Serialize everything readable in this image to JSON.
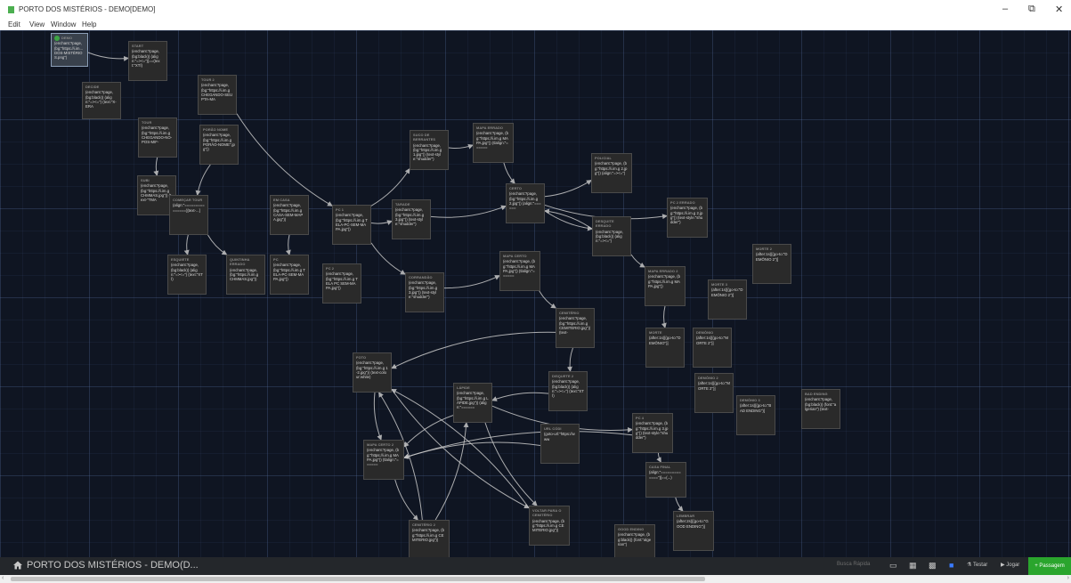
{
  "window": {
    "title": "PORTO DOS MISTÉRIOS - DEMO[DEMO]",
    "minimize": "–",
    "maximize": "⧉",
    "close": "✕"
  },
  "menu": [
    "Edit",
    "View",
    "Window",
    "Help"
  ],
  "colors": {
    "canvas_bg": "#0f1522",
    "passage_bg": "#2a2a2a",
    "link": "#c8c8c8",
    "accent_green": "#2aa52d",
    "selected_blue": "#3a7bff"
  },
  "passages": [
    {
      "id": "p0",
      "name": "DEMO",
      "excerpt": "(enchant:?page, (bg:\"https://i.im... DOS-MISTÉRIOS.png\")",
      "start": true
    },
    {
      "id": "p1",
      "name": "START",
      "excerpt": "(enchant:?page, (bg:black)) (align:\"=><=\")[==(text:\"XTÍ)"
    },
    {
      "id": "p2",
      "name": "DECIDE",
      "excerpt": "(enchant:?page, (bg:black)) (align:\"=><=\") (text:\"X-ERA"
    },
    {
      "id": "p3",
      "name": "TOUR 2",
      "excerpt": "(enchant:?page, (bg:\"https://i.im.g CHEGANDO-SEUPTA-MA"
    },
    {
      "id": "p4",
      "name": "TOUR",
      "excerpt": "(enchant:?page, (bg:\"https://i.im.g CHEGANDO-NO-POS-MIF-"
    },
    {
      "id": "p5",
      "name": "PORÃO NOME",
      "excerpt": "(enchant:?page, (bg:\"https://i.im.g PORÃO-NOME\".jpg\"))"
    },
    {
      "id": "p6",
      "name": "SUBI",
      "excerpt": "(enchant:?page, (bg:\"https://i.im.g CHMMAS.jpg\")) (text-\"TMA"
    },
    {
      "id": "p7",
      "name": "COMEÇAR TOUR",
      "excerpt": "(align:\"===============)[text-...]"
    },
    {
      "id": "p8",
      "name": "EM CASA",
      "excerpt": "(enchant:?page, (bg:\"https://i.im.g CASA-SEM-MAPA.jpg\"))"
    },
    {
      "id": "p9",
      "name": "PC 1",
      "excerpt": "(enchant:?page, (bg:\"https://i.im.g TELA-PC-SEM-MAPA.jpg\"))"
    },
    {
      "id": "p10",
      "name": "SUCO DE BERRANTES",
      "excerpt": "(enchant:?page, (bg:\"https://i.im.g 1.jpg\")) (text-style:\"shudder\")"
    },
    {
      "id": "p11",
      "name": "MAPA ERRADO",
      "excerpt": "(enchant:?page, (bg:\"https://i.im.g MAPA.jpg\")) (tlalign:\"======"
    },
    {
      "id": "p12",
      "name": "POLICIAL",
      "excerpt": "(enchant:?page, (bg:\"https://i.im.g 2.jpg\")) (align:\"=><=\")"
    },
    {
      "id": "p13",
      "name": "TARADE",
      "excerpt": "(enchant:?page, (bg:\"https://i.im.g 3.jpg\")) (text-style:\"shudder\")"
    },
    {
      "id": "p14",
      "name": "CERTO",
      "excerpt": "(enchant:?page, (bg:\"https://i.im.g 2.jpg\")) (align:\"======"
    },
    {
      "id": "p15",
      "name": "PC 2 ERRADO",
      "excerpt": "(enchant:?page, (bg:\"https://i.im.g 2.jpg\")) (text-style:\"shudder\")"
    },
    {
      "id": "p16",
      "name": "DESQUITE ERRADO",
      "excerpt": "(enchant:?page, (bg:black)) (align:\"=><=\")"
    },
    {
      "id": "p17",
      "name": "ESQUIETE",
      "excerpt": "(enchant:?page, (bg:black)) (align:\"=><=\") (text:\"XTÍ)"
    },
    {
      "id": "p18",
      "name": "QUINTINHA ERRADO",
      "excerpt": "(enchant:?page, (bg:\"https://i.im.g CHMMAS.jpg\"))"
    },
    {
      "id": "p19",
      "name": "PC",
      "excerpt": "(enchant:?page, (bg:\"https://i.im.g TELA-PC-SEM-MAPA.jpg\"))"
    },
    {
      "id": "p20",
      "name": "PC 2",
      "excerpt": "(enchant:?page, (bg:\"https://i.im.g TELA PC SEM-MAPA.jpg\"))"
    },
    {
      "id": "p21",
      "name": "CORRANDÃO",
      "excerpt": "(enchant:?page, (bg:\"https://i.im.g 3.jpg\")) (text-style:\"shudder\")"
    },
    {
      "id": "p22",
      "name": "MAPA CERTO",
      "excerpt": "(enchant:?page, (bg:\"https://i.im.g MAPA.jpg\")) (tlalign:\"======"
    },
    {
      "id": "p23",
      "name": "MAPA ERRADO 2",
      "excerpt": "(enchant:?page, (bg:\"https://i.im.g MAPA.jpg\"))"
    },
    {
      "id": "p24",
      "name": "MORTE 2",
      "excerpt": "(after:1s)[(go-to:\"DEMÔNIO 2\")]"
    },
    {
      "id": "p25",
      "name": "MORTE 3",
      "excerpt": "(after:1s)[(go-to:\"DEMÔNIO 2\")]"
    },
    {
      "id": "p26",
      "name": "CEMITÉRIO",
      "excerpt": "(enchant:?page, (bg:\"https://i.im.g CEMITERIO.jpg\")) (text-"
    },
    {
      "id": "p27",
      "name": "MORTE",
      "excerpt": "(after:1s)[(go-to:\"DEMÔNIO\")]"
    },
    {
      "id": "p28",
      "name": "DEMÔNIO",
      "excerpt": "(after:1s)[(go-to:\"MORTE 2\")]"
    },
    {
      "id": "p29",
      "name": "DEMÔNIO 2",
      "excerpt": "(after:1s)[(go-to:\"MORTE 2\")]"
    },
    {
      "id": "p30",
      "name": "FOTO",
      "excerpt": "(enchant:?page, (bg:\"https://i.im.g 1-2.jpg\")) (text-colour:white)"
    },
    {
      "id": "p31",
      "name": "DEMÔNIO 3",
      "excerpt": "(after:1s)[(go-to:\"BAD ENDING\")]"
    },
    {
      "id": "p32",
      "name": "BAD ENDING",
      "excerpt": "(enchant:?page, (bg:black)) (font:\"algerian\") (text-"
    },
    {
      "id": "p33",
      "name": "LÁPIDE",
      "excerpt": "(enchant:?page, (bg:\"https://i.im.g LÁPIDE.jpg\")) (align:\"======"
    },
    {
      "id": "p34",
      "name": "DISQUETE 2",
      "excerpt": "(enchant:?page, (bg:black)) (align:\"=><=\") (text:\"XTÍ)"
    },
    {
      "id": "p35",
      "name": "PC 4",
      "excerpt": "(enchant:?page, (bg:\"https://i.im.g 3.jpg\")) (text-style:\"shudder\")"
    },
    {
      "id": "p36",
      "name": "URL CÓDI",
      "excerpt": "(goto-url:\"https://www"
    },
    {
      "id": "p37",
      "name": "MAPA CERTO 2",
      "excerpt": "(enchant:?page, (bg:\"https://i.im.g MAPA.jpg\")) (tlalign:\"======"
    },
    {
      "id": "p38",
      "name": "CASA FINAL",
      "excerpt": "(align:\"=============\")[==(...)"
    },
    {
      "id": "p39",
      "name": "VOLTAR PARA O CEMITÉRIO",
      "excerpt": "(enchant:?page, (bg:\"https://i.im.g CEMITERIO.jpg\"))"
    },
    {
      "id": "p40",
      "name": "CEMITÉRIO 2",
      "excerpt": "(enchant:?page, (bg:\"https://i.im.g CEMITERIO.jpg\"))"
    },
    {
      "id": "p41",
      "name": "LEMBRAR",
      "excerpt": "(after:2s)[(go-to:\"GOOD ENDING\")]"
    },
    {
      "id": "p42",
      "name": "GOOD ENDING",
      "excerpt": "(enchant:?page, (bg:black)) (font:\"algerian\")"
    }
  ],
  "links": [
    [
      "p0",
      "p1"
    ],
    [
      "p3",
      "p9"
    ],
    [
      "p4",
      "p6"
    ],
    [
      "p5",
      "p7"
    ],
    [
      "p6",
      "p7"
    ],
    [
      "p7",
      "p17"
    ],
    [
      "p7",
      "p18"
    ],
    [
      "p8",
      "p19"
    ],
    [
      "p9",
      "p10"
    ],
    [
      "p9",
      "p13"
    ],
    [
      "p9",
      "p21"
    ],
    [
      "p10",
      "p11"
    ],
    [
      "p11",
      "p14"
    ],
    [
      "p13",
      "p14"
    ],
    [
      "p14",
      "p12"
    ],
    [
      "p14",
      "p15"
    ],
    [
      "p14",
      "p16"
    ],
    [
      "p16",
      "p14"
    ],
    [
      "p16",
      "p23"
    ],
    [
      "p21",
      "p22"
    ],
    [
      "p22",
      "p26"
    ],
    [
      "p23",
      "p27"
    ],
    [
      "p26",
      "p30"
    ],
    [
      "p26",
      "p34"
    ],
    [
      "p30",
      "p37"
    ],
    [
      "p30",
      "p39"
    ],
    [
      "p33",
      "p37"
    ],
    [
      "p33",
      "p35"
    ],
    [
      "p33",
      "p39"
    ],
    [
      "p35",
      "p38"
    ],
    [
      "p36",
      "p37"
    ],
    [
      "p37",
      "p40"
    ],
    [
      "p38",
      "p41"
    ],
    [
      "p35",
      "p37"
    ],
    [
      "p34",
      "p33"
    ],
    [
      "p40",
      "p33"
    ],
    [
      "p39",
      "p30"
    ],
    [
      "p40",
      "p30"
    ]
  ],
  "bottom": {
    "story_name": "PORTO DOS MISTÉRIOS - DEMO(D...",
    "quick_find": "Busca Rápida",
    "test_label": "Testar",
    "play_label": "Jogar",
    "add_label": "+ Passagem"
  }
}
